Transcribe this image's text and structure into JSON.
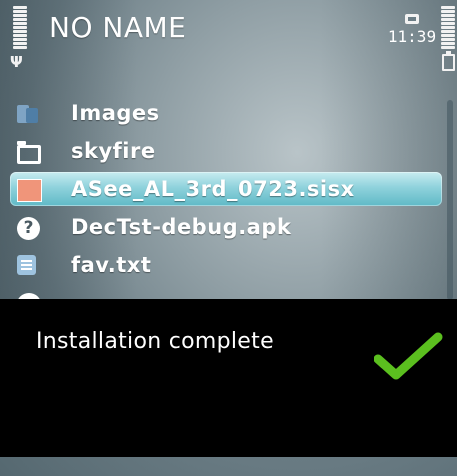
{
  "status_bar": {
    "title": "NO NAME",
    "time": "11:39"
  },
  "files": [
    {
      "name": "Images",
      "icon": "images-folder-icon",
      "selected": false
    },
    {
      "name": "skyfire",
      "icon": "folder-icon",
      "selected": false
    },
    {
      "name": "ASee_AL_3rd_0723.sisx",
      "icon": "sisx-file-icon",
      "selected": true
    },
    {
      "name": "DecTst-debug.apk",
      "icon": "unknown-file-icon",
      "selected": false
    },
    {
      "name": "fav.txt",
      "icon": "text-file-icon",
      "selected": false
    }
  ],
  "popup": {
    "message": "Installation complete",
    "icon": "checkmark-icon"
  },
  "colors": {
    "selection": "#8fd2dc",
    "check": "#5bbf1f",
    "popup_bg": "#000000"
  }
}
